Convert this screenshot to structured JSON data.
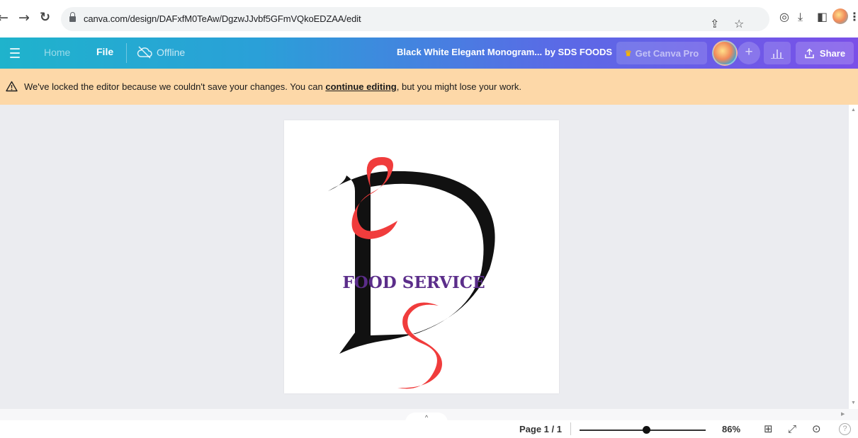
{
  "browser": {
    "url": "canva.com/design/DAFxfM0TeAw/DgzwJJvbf5GFmVQkoEDZAA/edit"
  },
  "header": {
    "home_label": "Home",
    "file_label": "File",
    "status_label": "Offline",
    "design_title": "Black White Elegant Monogram... by SDS FOODS",
    "pro_label": "Get Canva Pro",
    "share_label": "Share"
  },
  "banner": {
    "text_before": "We've locked the editor because we couldn't save your changes. You can ",
    "link_text": "continue editing",
    "text_after": ", but you might lose your work."
  },
  "canvas": {
    "logo_text": "FOOD SERVICE",
    "colors": {
      "letter_black": "#111111",
      "letter_red": "#f03c3c",
      "text_purple": "#5b2d8a"
    }
  },
  "footer": {
    "page_label": "Page 1 / 1",
    "zoom_label": "86%",
    "zoom_level": 0.53
  },
  "theme": {
    "banner_bg": "#fdd8a8",
    "workspace_bg": "#ebecf0"
  }
}
